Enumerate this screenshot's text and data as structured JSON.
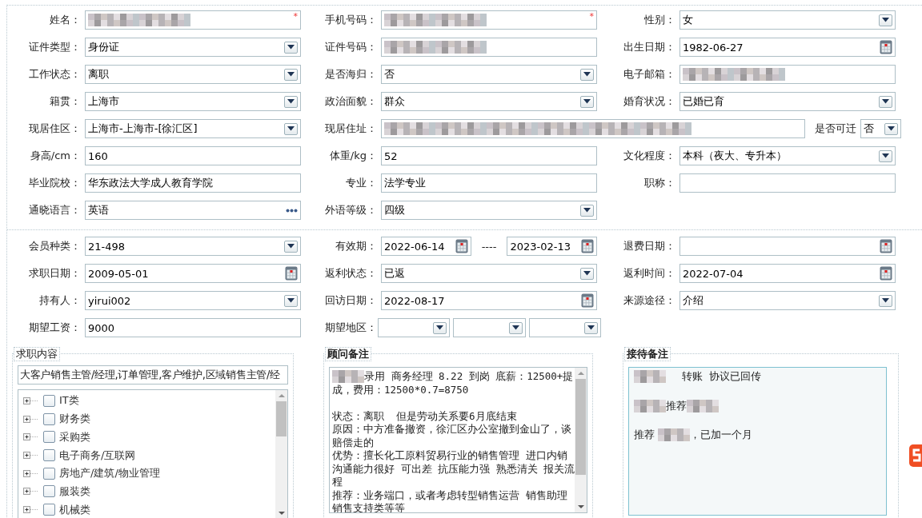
{
  "sections": [
    {
      "rows": [
        {
          "cells": [
            {
              "label": "姓名：",
              "fields": [
                {
                  "kind": "text",
                  "redacted": true,
                  "required_mark": "*"
                }
              ]
            },
            {
              "label": "手机号码：",
              "fields": [
                {
                  "kind": "text",
                  "redacted": true,
                  "required_mark": "*"
                }
              ]
            },
            {
              "label": "性别：",
              "fields": [
                {
                  "kind": "select",
                  "value": "女"
                }
              ]
            }
          ]
        },
        {
          "cells": [
            {
              "label": "证件类型：",
              "fields": [
                {
                  "kind": "select",
                  "value": "身份证"
                }
              ]
            },
            {
              "label": "证件号码：",
              "fields": [
                {
                  "kind": "text",
                  "redacted": true
                }
              ]
            },
            {
              "label": "出生日期：",
              "fields": [
                {
                  "kind": "date",
                  "value": "1982-06-27"
                }
              ]
            }
          ]
        },
        {
          "cells": [
            {
              "label": "工作状态：",
              "fields": [
                {
                  "kind": "select",
                  "value": "离职"
                }
              ]
            },
            {
              "label": "是否海归：",
              "fields": [
                {
                  "kind": "select",
                  "value": "否"
                }
              ]
            },
            {
              "label": "电子邮箱：",
              "fields": [
                {
                  "kind": "text",
                  "redacted": true
                }
              ]
            }
          ]
        },
        {
          "cells": [
            {
              "label": "籍贯：",
              "fields": [
                {
                  "kind": "select",
                  "value": "上海市"
                }
              ]
            },
            {
              "label": "政治面貌：",
              "fields": [
                {
                  "kind": "select",
                  "value": "群众"
                }
              ]
            },
            {
              "label": "婚育状况：",
              "fields": [
                {
                  "kind": "select",
                  "value": "已婚已育"
                }
              ]
            }
          ]
        },
        {
          "cells": [
            {
              "label": "现居住区：",
              "fields": [
                {
                  "kind": "select",
                  "value": "上海市-上海市-[徐汇区]"
                }
              ]
            },
            {
              "label": "现居住址：",
              "fields": [
                {
                  "kind": "text",
                  "redacted": true
                }
              ],
              "trailing": {
                "label": "是否可迁",
                "fields": [
                  {
                    "kind": "select",
                    "value": "否"
                  }
                ]
              }
            }
          ]
        },
        {
          "cells": [
            {
              "label": "身高/cm：",
              "fields": [
                {
                  "kind": "text",
                  "value": "160"
                }
              ]
            },
            {
              "label": "体重/kg：",
              "fields": [
                {
                  "kind": "text",
                  "value": "52"
                }
              ]
            },
            {
              "label": "文化程度：",
              "fields": [
                {
                  "kind": "select",
                  "value": "本科（夜大、专升本）"
                }
              ]
            }
          ]
        },
        {
          "cells": [
            {
              "label": "毕业院校：",
              "fields": [
                {
                  "kind": "text",
                  "value": "华东政法大学成人教育学院"
                }
              ]
            },
            {
              "label": "专业：",
              "fields": [
                {
                  "kind": "text",
                  "value": "法学专业"
                }
              ]
            },
            {
              "label": "职称：",
              "fields": [
                {
                  "kind": "text"
                }
              ]
            }
          ]
        },
        {
          "cells": [
            {
              "label": "通晓语言：",
              "fields": [
                {
                  "kind": "more",
                  "value": "英语"
                }
              ]
            },
            {
              "label": "外语等级：",
              "fields": [
                {
                  "kind": "select",
                  "value": "四级"
                }
              ]
            }
          ]
        }
      ]
    },
    {
      "rows": [
        {
          "cells": [
            {
              "label": "会员种类：",
              "fields": [
                {
                  "kind": "select",
                  "value": "21-498"
                }
              ]
            },
            {
              "label": "有效期：",
              "separator": "----",
              "fields": [
                {
                  "kind": "date",
                  "value": "2022-06-14"
                },
                {
                  "kind": "date",
                  "value": "2023-02-13"
                }
              ]
            },
            {
              "label": "退费日期：",
              "fields": [
                {
                  "kind": "date"
                }
              ]
            }
          ]
        },
        {
          "cells": [
            {
              "label": "求职日期：",
              "fields": [
                {
                  "kind": "date",
                  "value": "2009-05-01"
                }
              ]
            },
            {
              "label": "返利状态：",
              "fields": [
                {
                  "kind": "select",
                  "value": "已返"
                }
              ]
            },
            {
              "label": "返利时间：",
              "fields": [
                {
                  "kind": "date",
                  "value": "2022-07-04"
                }
              ]
            }
          ]
        },
        {
          "cells": [
            {
              "label": "持有人：",
              "fields": [
                {
                  "kind": "select",
                  "value": "yirui002"
                }
              ]
            },
            {
              "label": "回访日期：",
              "fields": [
                {
                  "kind": "date",
                  "value": "2022-08-17"
                }
              ]
            },
            {
              "label": "来源途径：",
              "fields": [
                {
                  "kind": "select",
                  "value": "介绍"
                }
              ]
            }
          ]
        },
        {
          "cells": [
            {
              "label": "期望工资：",
              "fields": [
                {
                  "kind": "text",
                  "value": "9000"
                }
              ]
            },
            {
              "label": "期望地区：",
              "fields": [
                {
                  "kind": "select"
                },
                {
                  "kind": "select"
                },
                {
                  "kind": "select"
                }
              ]
            }
          ]
        }
      ]
    }
  ],
  "job_panel": {
    "legend": "求职内容",
    "summary": "大客户销售主管/经理,订单管理,客户维护,区域销售主管/经",
    "tree": [
      {
        "label": "IT类",
        "expanded": false,
        "checked": false
      },
      {
        "label": "财务类",
        "expanded": false,
        "checked": false
      },
      {
        "label": "采购类",
        "expanded": false,
        "checked": false
      },
      {
        "label": "电子商务/互联网",
        "expanded": false,
        "checked": false
      },
      {
        "label": "房地产/建筑/物业管理",
        "expanded": false,
        "checked": false
      },
      {
        "label": "服装类",
        "expanded": false,
        "checked": false
      },
      {
        "label": "机械类",
        "expanded": false,
        "checked": false
      }
    ]
  },
  "advisor_notes": {
    "legend": "顾问备注",
    "paragraphs": [
      [
        [
          {
            "kind": "redacted"
          },
          {
            "text": "录用 商务经理 8.22 到岗 底薪：12500+提"
          }
        ],
        [
          {
            "text": "成，费用：12500*0.7=8750"
          }
        ]
      ],
      [
        [
          {
            "text": "状态：离职  但是劳动关系要6月底结束"
          }
        ],
        [
          {
            "text": "原因：中方准备撤资，徐汇区办公室撤到金山了，谈"
          }
        ],
        [
          {
            "text": "赔偿走的"
          }
        ],
        [
          {
            "text": "优势：擅长化工原料贸易行业的销售管理 进口内销"
          }
        ],
        [
          {
            "text": "沟通能力很好 可出差 抗压能力强 熟悉清关 报关流"
          }
        ],
        [
          {
            "text": "程"
          }
        ],
        [
          {
            "text": "推荐：业务端口，或者考虑转型销售运营 销售助理"
          }
        ],
        [
          {
            "text": "销售支持类等等"
          }
        ]
      ]
    ]
  },
  "reception_notes": {
    "legend": "接待备注",
    "paragraphs": [
      [
        [
          {
            "kind": "redacted"
          },
          {
            "text": "     转账  协议已回传"
          }
        ]
      ],
      [
        [
          {
            "kind": "redacted"
          },
          {
            "text": "推荐"
          },
          {
            "kind": "redacted"
          }
        ]
      ],
      [
        [
          {
            "text": "推荐 "
          },
          {
            "kind": "redacted"
          },
          {
            "text": "，已加一个月"
          }
        ]
      ]
    ]
  }
}
